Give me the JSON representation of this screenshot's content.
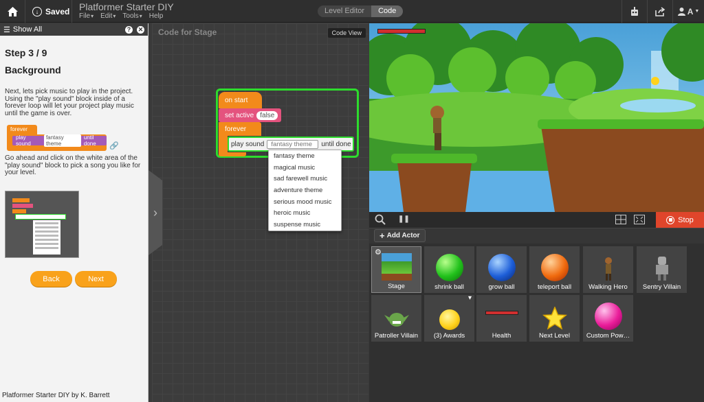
{
  "topbar": {
    "saved": "Saved",
    "app_title": "Platformer Starter DIY",
    "menu": [
      "File",
      "Edit",
      "Tools",
      "Help"
    ],
    "modes": [
      "Level Editor",
      "Code"
    ],
    "user": "A"
  },
  "left": {
    "show_all": "Show All",
    "step": "Step 3 / 9",
    "heading": "Background",
    "para1": "Next, lets pick music to play in the project. Using the \"play sound\" block inside of a forever loop will let your project play music until the game is over.",
    "para2": "Go ahead and click on the white area of the \"play sound\" block to pick a song you like for your level.",
    "mini_forever": "forever",
    "mini_play": "play sound",
    "mini_theme": "fantasy theme",
    "mini_until": "until done",
    "back": "Back",
    "next": "Next",
    "credit": "Platformer Starter DIY by K. Barrett"
  },
  "code": {
    "title": "Code for Stage",
    "code_view": "Code View",
    "on_start": "on start",
    "set_active": "set active",
    "false": "false",
    "forever": "forever",
    "play_sound": "play sound",
    "theme": "fantasy theme",
    "until_done": "until done",
    "options": [
      "fantasy theme",
      "magical music",
      "sad farewell music",
      "adventure theme",
      "serious mood music",
      "heroic music",
      "suspense music"
    ]
  },
  "stage_bar": {
    "stop": "Stop"
  },
  "actors": {
    "add": "Add Actor",
    "items": [
      "Stage",
      "shrink ball",
      "grow ball",
      "teleport ball",
      "Walking Hero",
      "Sentry Villain",
      "Patroller Villain",
      "(3) Awards",
      "Health",
      "Next Level",
      "Custom Pow…"
    ]
  },
  "colors": {
    "orange": "#f9a21b",
    "event": "#f28a1b",
    "purple": "#a45ab8",
    "pink": "#e4537e",
    "green_hl": "#2ddc2d",
    "stop": "#e0452b"
  }
}
